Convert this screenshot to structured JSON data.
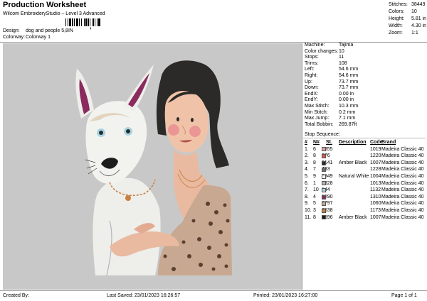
{
  "header": {
    "title": "Production Worksheet",
    "subtitle": "Wilcom EmbroideryStudio – Level 3 Advanced",
    "barcode_mark": ",",
    "design_label": "Design:",
    "design_value": "dog and people 5,8IN",
    "colorway_label": "Colorway:",
    "colorway_value": "Colorway 1"
  },
  "stats": [
    {
      "label": "Stitches:",
      "value": "38449"
    },
    {
      "label": "Colors:",
      "value": "10"
    },
    {
      "label": "Height:",
      "value": "5.81 in"
    },
    {
      "label": "Width:",
      "value": "4.30 in"
    },
    {
      "label": "Zoom:",
      "value": "1:1"
    }
  ],
  "machine_info": [
    {
      "label": "Machine:",
      "value": "Tajima"
    },
    {
      "label": "Color changes:",
      "value": "10"
    },
    {
      "label": "Stops:",
      "value": "11"
    },
    {
      "label": "Trims:",
      "value": "108"
    },
    {
      "label": "Left:",
      "value": "54.6 mm"
    },
    {
      "label": "Right:",
      "value": "54.6 mm"
    },
    {
      "label": "Up:",
      "value": "73.7 mm"
    },
    {
      "label": "Down:",
      "value": "73.7 mm"
    },
    {
      "label": "EndX:",
      "value": "0.00 in"
    },
    {
      "label": "EndY:",
      "value": "0.00 in"
    },
    {
      "label": "Max Stitch:",
      "value": "10.3 mm"
    },
    {
      "label": "Min Stitch:",
      "value": "0.2 mm"
    },
    {
      "label": "Max Jump:",
      "value": "7.1 mm"
    },
    {
      "label": "Total Bobbin:",
      "value": "269.87ft"
    }
  ],
  "sequence": {
    "title": "Stop Sequence:",
    "columns": [
      "#",
      "N#",
      "",
      "St.",
      "Description",
      "Code",
      "Brand"
    ],
    "rows": [
      {
        "num": "1.",
        "n": "6",
        "color": "#e8a0a0",
        "st": "8855",
        "desc": "",
        "code": "1019",
        "brand": "Madeira Classic 40"
      },
      {
        "num": "2.",
        "n": "8",
        "color": "#d8584a",
        "st": "376",
        "desc": "",
        "code": "1220",
        "brand": "Madeira Classic 40"
      },
      {
        "num": "3.",
        "n": "8",
        "color": "#2a2a2a",
        "st": "2141",
        "desc": "Amber Black",
        "code": "1007",
        "brand": "Madeira Classic 40"
      },
      {
        "num": "4.",
        "n": "7",
        "color": "#6e6e6e",
        "st": "433",
        "desc": "",
        "code": "1228",
        "brand": "Madeira Classic 40"
      },
      {
        "num": "5.",
        "n": "9",
        "color": "#f4f4f2",
        "st": "9949",
        "desc": "Natural White",
        "code": "1004",
        "brand": "Madeira Classic 40"
      },
      {
        "num": "6.",
        "n": "1",
        "color": "#b4b4ba",
        "st": "1328",
        "desc": "",
        "code": "1013",
        "brand": "Madeira Classic 40"
      },
      {
        "num": "7.",
        "n": "10",
        "color": "#a8d4e4",
        "st": "144",
        "desc": "",
        "code": "1132",
        "brand": "Madeira Classic 40"
      },
      {
        "num": "8.",
        "n": "4",
        "color": "#8a2a5e",
        "st": "1290",
        "desc": "",
        "code": "1310",
        "brand": "Madeira Classic 40"
      },
      {
        "num": "9.",
        "n": "5",
        "color": "#c8a890",
        "st": "3797",
        "desc": "",
        "code": "1060",
        "brand": "Madeira Classic 40"
      },
      {
        "num": "10.",
        "n": "3",
        "color": "#c88040",
        "st": "2538",
        "desc": "",
        "code": "1173",
        "brand": "Madeira Classic 40"
      },
      {
        "num": "11.",
        "n": "8",
        "color": "#1c1c1c",
        "st": "7596",
        "desc": "Amber Black",
        "code": "1007",
        "brand": "Madeira Classic 40"
      }
    ]
  },
  "footer": {
    "created_by": "Created By:",
    "last_saved": "Last Saved: 23/01/2023 16:26:57",
    "printed": "Printed: 23/01/2023 16:27:00",
    "page": "Page 1 of 1"
  },
  "colors": {
    "canvas_bg": "#c8c8c8",
    "separator": "#9a9a9a"
  }
}
